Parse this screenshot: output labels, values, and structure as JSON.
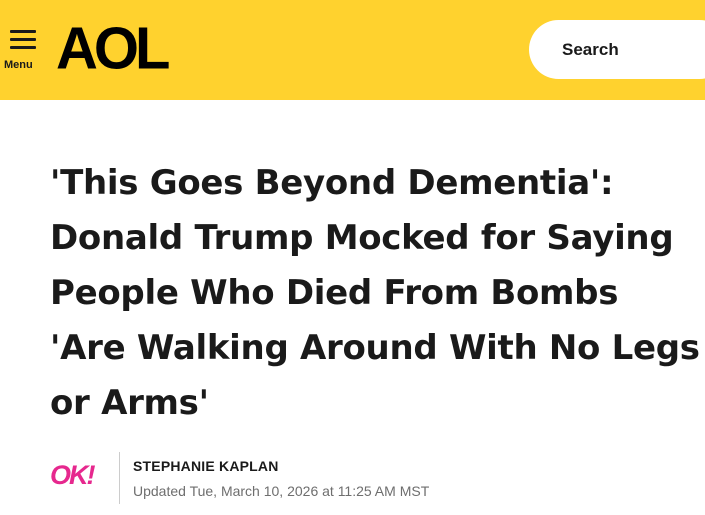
{
  "header": {
    "menu_label": "Menu",
    "logo_text": "AOL",
    "search_label": "Search",
    "colors": {
      "brand_yellow": "#ffd22e",
      "text": "#1a1a1a"
    }
  },
  "article": {
    "headline": "'This Goes Beyond Dementia': Donald Trump Mocked for Saying People Who Died From Bombs 'Are Walking Around With No Legs or Arms'",
    "source_logo_text": "OK!",
    "source_color": "#e6288e",
    "author": "STEPHANIE KAPLAN",
    "updated": "Updated Tue, March 10, 2026 at 11:25 AM MST"
  }
}
